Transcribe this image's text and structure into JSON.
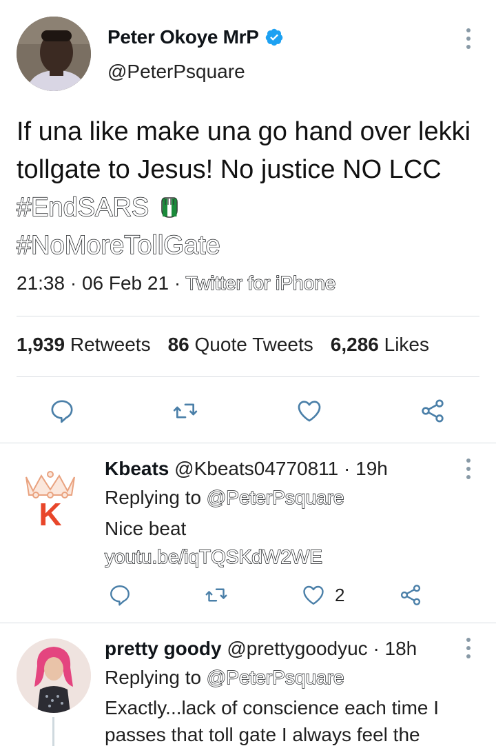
{
  "main_tweet": {
    "display_name": "Peter Okoye MrP",
    "handle": "@PeterPsquare",
    "verified": true,
    "text_plain_1": "If una like make una go hand over lekki tollgate to Jesus! No justice NO LCC ",
    "hashtag_1": "#EndSARS",
    "hashtag_2": "#NoMoreTollGate",
    "timestamp": "21:38 · 06 Feb 21 · ",
    "source": "Twitter for iPhone",
    "stats": {
      "retweets_count": "1,939",
      "retweets_label": "Retweets",
      "quotes_count": "86",
      "quotes_label": "Quote Tweets",
      "likes_count": "6,286",
      "likes_label": "Likes"
    }
  },
  "replies": [
    {
      "display_name": "Kbeats",
      "handle": "@Kbeats04770811",
      "time": "· 19h",
      "replying_label": "Replying to ",
      "replying_to": "@PeterPsquare",
      "text": "Nice beat",
      "link": "youtu.be/iqTQSKdW2WE",
      "avatar_letter": "K",
      "like_count": "2"
    },
    {
      "display_name": "pretty goody",
      "handle": "@prettygoodyuc",
      "time": "· 18h",
      "replying_label": "Replying to ",
      "replying_to": "@PeterPsquare",
      "text_line_1": "Exactly...lack of conscience each time I",
      "text_line_2": "passes that toll gate I always feel the"
    }
  ],
  "icons": {
    "verified": "verified-badge-icon",
    "reply": "reply-icon",
    "retweet": "retweet-icon",
    "like": "heart-icon",
    "share": "share-icon",
    "more": "more-vertical-icon"
  },
  "colors": {
    "verified_blue": "#1da1f2",
    "icon_blue_gray": "#4a7fa8",
    "icon_gray": "#657786",
    "divider": "#d8dde2",
    "kbeats_orange": "#e8462a"
  }
}
